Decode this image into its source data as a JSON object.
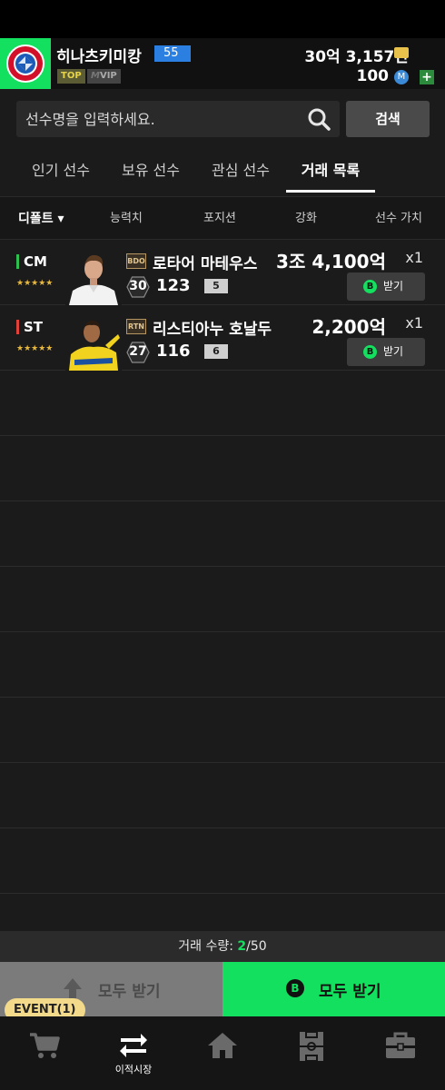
{
  "profile": {
    "nickname": "히나츠키미캉",
    "level": "55",
    "badge_top": "TOP",
    "badge_vip": "VIP",
    "money": "30억 3,157만",
    "points": "100"
  },
  "search": {
    "placeholder": "선수명을 입력하세요.",
    "button_label": "검색"
  },
  "tabs": [
    {
      "label": "인기 선수",
      "active": false
    },
    {
      "label": "보유 선수",
      "active": false
    },
    {
      "label": "관심 선수",
      "active": false
    },
    {
      "label": "거래 목록",
      "active": true
    }
  ],
  "columns": {
    "sort": "디폴트 ▾",
    "ability": "능력치",
    "position": "포지션",
    "enhance": "강화",
    "value": "선수 가치"
  },
  "players": [
    {
      "position": "CM",
      "position_color": "#2fbf4f",
      "stars": "★★★★★",
      "season": "BDO",
      "name": "로타어 마테우스",
      "ovr": "30",
      "rating": "123",
      "enhance": "5",
      "price": "3조 4,100억",
      "qty": "x1",
      "receive_label": "받기"
    },
    {
      "position": "ST",
      "position_color": "#e0413a",
      "stars": "★★★★★",
      "season": "RTN",
      "name": "리스티아누 호날두",
      "ovr": "27",
      "rating": "116",
      "enhance": "6",
      "price": "2,200억",
      "qty": "x1",
      "receive_label": "받기"
    }
  ],
  "trade_count": {
    "label": "거래 수량: ",
    "current": "2",
    "max": "/50"
  },
  "footer_buttons": {
    "left_label": "모두 받기",
    "right_label": "모두 받기"
  },
  "event_badge": "EVENT(1)",
  "nav": {
    "transfer_label": "이적시장"
  },
  "colors": {
    "accent": "#14e05f",
    "background": "#1b1b1b"
  }
}
